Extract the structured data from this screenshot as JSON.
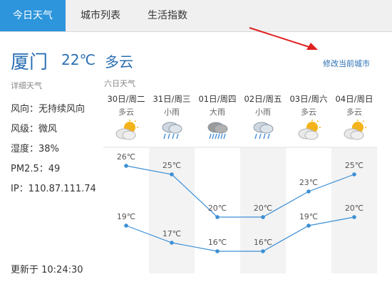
{
  "tabs": [
    "今日天气",
    "城市列表",
    "生活指数"
  ],
  "today": {
    "city": "厦门",
    "temp": "22℃",
    "condition": "多云"
  },
  "change_city": "修改当前城市",
  "detail_title": "详细天气",
  "details": [
    "风向：无持续风向",
    "风级：微风",
    "湿度：38%",
    "PM2.5：49",
    "IP：110.87.111.74"
  ],
  "updated": "更新于 10:24:30",
  "forecast_title": "六日天气",
  "forecast": [
    {
      "date": "30日/周二",
      "cond": "多云",
      "icon": "partly-cloudy-icon"
    },
    {
      "date": "31日/周三",
      "cond": "小雨",
      "icon": "light-rain-icon"
    },
    {
      "date": "01日/周四",
      "cond": "大雨",
      "icon": "heavy-rain-icon"
    },
    {
      "date": "02日/周五",
      "cond": "小雨",
      "icon": "light-rain-icon"
    },
    {
      "date": "03日/周六",
      "cond": "多云",
      "icon": "partly-cloudy-icon"
    },
    {
      "date": "04日/周日",
      "cond": "多云",
      "icon": "partly-cloudy-icon"
    }
  ],
  "chart_data": {
    "type": "line",
    "categories": [
      "30日/周二",
      "31日/周三",
      "01日/周四",
      "02日/周五",
      "03日/周六",
      "04日/周日"
    ],
    "series": [
      {
        "values": [
          26,
          25,
          20,
          20,
          23,
          25
        ],
        "labels": [
          "26℃",
          "25℃",
          "20℃",
          "20℃",
          "23℃",
          "25℃"
        ]
      },
      {
        "values": [
          19,
          17,
          16,
          16,
          19,
          20
        ],
        "labels": [
          "19℃",
          "17℃",
          "16℃",
          "16℃",
          "19℃",
          "20℃"
        ]
      }
    ],
    "colors": {
      "line": "#3b8fd6",
      "alt_band": "#f3f3f3"
    }
  }
}
